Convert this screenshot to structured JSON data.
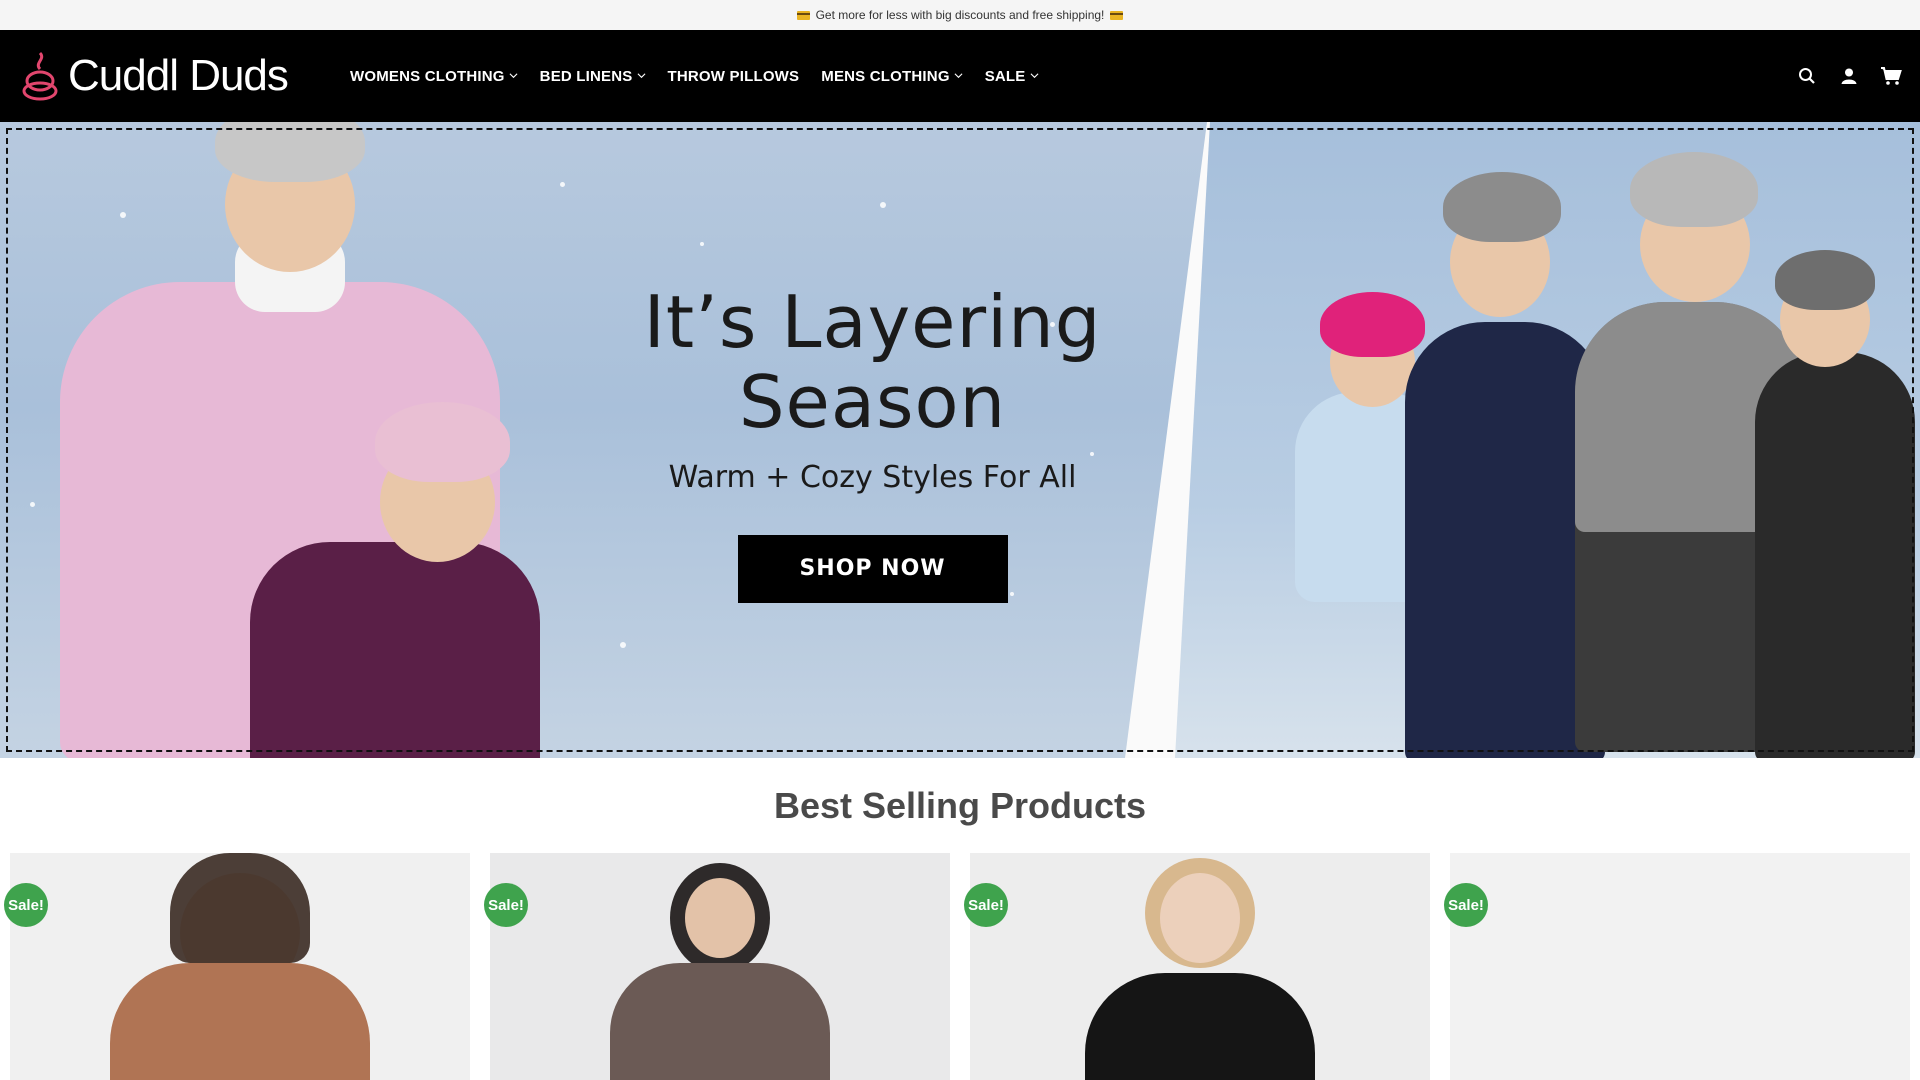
{
  "promo": {
    "text": "Get more for less with big discounts and free shipping!"
  },
  "brand": {
    "name": "Cuddl Duds",
    "accent": "#e2466e"
  },
  "nav": [
    {
      "label": "WOMENS CLOTHING",
      "dropdown": true
    },
    {
      "label": "BED LINENS",
      "dropdown": true
    },
    {
      "label": "THROW PILLOWS",
      "dropdown": false
    },
    {
      "label": "MENS CLOTHING",
      "dropdown": true
    },
    {
      "label": "SALE",
      "dropdown": true
    }
  ],
  "header_icons": [
    "search-icon",
    "account-icon",
    "cart-icon"
  ],
  "hero": {
    "title_line1": "It’s Layering",
    "title_line2": "Season",
    "subtitle": "Warm + Cozy Styles For All",
    "cta": "SHOP NOW"
  },
  "section": {
    "title": "Best Selling Products"
  },
  "products": [
    {
      "badge": "Sale!"
    },
    {
      "badge": "Sale!"
    },
    {
      "badge": "Sale!"
    },
    {
      "badge": "Sale!"
    }
  ],
  "colors": {
    "sale_green": "#3fa34d",
    "header_bg": "#000000"
  }
}
